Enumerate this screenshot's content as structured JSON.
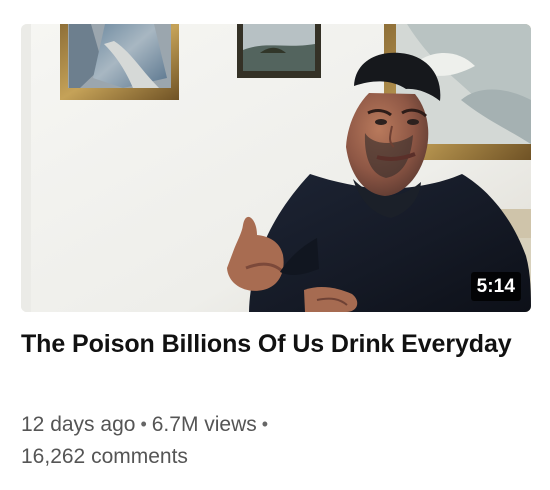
{
  "video": {
    "duration": "5:14",
    "title": "The Poison Billions Of Us Drink Everyday",
    "age": "12 days ago",
    "views": "6.7M views",
    "comments": "16,262 comments",
    "separator": "•"
  },
  "icons": {
    "play": "thumbnail-image"
  }
}
